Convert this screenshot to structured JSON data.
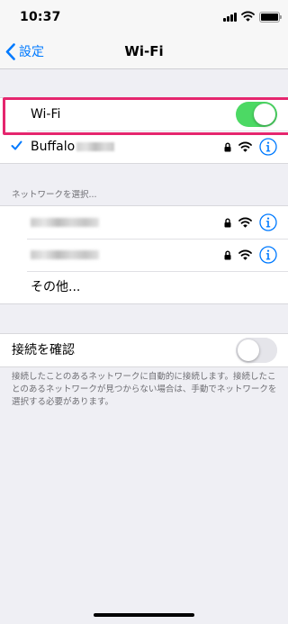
{
  "status_bar": {
    "time": "10:37"
  },
  "nav": {
    "back_label": "設定",
    "title": "Wi-Fi"
  },
  "wifi_toggle": {
    "label": "Wi-Fi",
    "state": "on"
  },
  "current_network": {
    "name": "Buffalo"
  },
  "network_section": {
    "header": "ネットワークを選択...",
    "other_label": "その他..."
  },
  "ask_to_join": {
    "label": "接続を確認",
    "state": "off",
    "footer": "接続したことのあるネットワークに自動的に接続します。接続したことのあるネットワークが見つからない場合は、手動でネットワークを選択する必要があります。"
  },
  "colors": {
    "accent": "#007aff",
    "toggle_on": "#4cd964",
    "highlight": "#e5266e"
  },
  "icons": [
    "chevron-left-icon",
    "checkmark-icon",
    "lock-icon",
    "wifi-icon",
    "info-icon",
    "signal-icon",
    "battery-icon"
  ]
}
